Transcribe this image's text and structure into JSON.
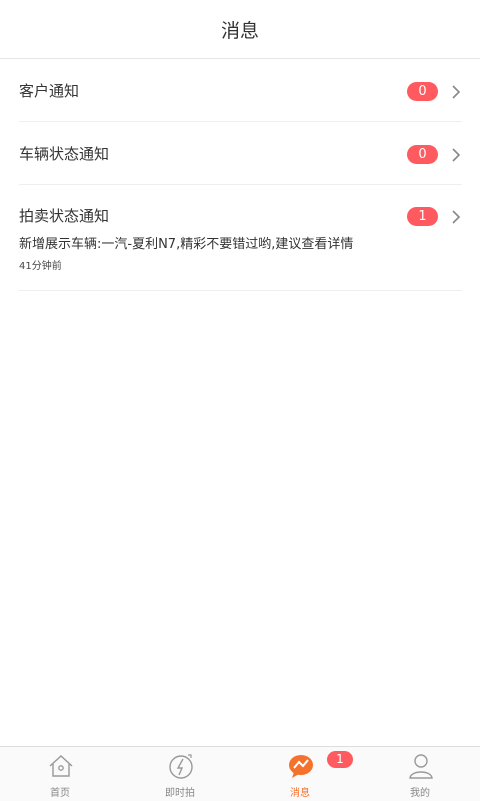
{
  "header": {
    "title": "消息"
  },
  "notifications": [
    {
      "title": "客户通知",
      "count": "0"
    },
    {
      "title": "车辆状态通知",
      "count": "0"
    },
    {
      "title": "拍卖状态通知",
      "count": "1",
      "message": "新增展示车辆:一汽-夏利N7,精彩不要错过哟,建议查看详情",
      "time": "41分钟前"
    }
  ],
  "tabbar": {
    "tabs": [
      {
        "label": "首页",
        "icon": "home-icon"
      },
      {
        "label": "即时拍",
        "icon": "lightning-icon"
      },
      {
        "label": "消息",
        "icon": "message-icon",
        "active": true
      },
      {
        "label": "我的",
        "icon": "user-icon"
      }
    ],
    "message_badge": "1"
  },
  "colors": {
    "badge": "#ff5a5f",
    "active_tab": "#f5722c",
    "inactive_tab": "#888888"
  }
}
